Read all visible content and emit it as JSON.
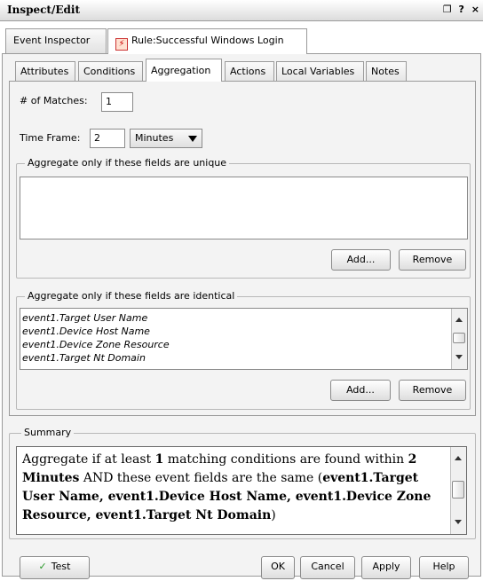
{
  "window": {
    "title": "Inspect/Edit",
    "controls": [
      "❐",
      "?",
      "×"
    ]
  },
  "outer_tabs": [
    {
      "label": "Event Inspector",
      "active": false
    },
    {
      "label": "Rule:Successful Windows Login",
      "active": true,
      "icon": "warning-icon"
    }
  ],
  "inner_tabs": [
    {
      "label": "Attributes",
      "active": false
    },
    {
      "label": "Conditions",
      "active": false
    },
    {
      "label": "Aggregation",
      "active": true
    },
    {
      "label": "Actions",
      "active": false
    },
    {
      "label": "Local Variables",
      "active": false
    },
    {
      "label": "Notes",
      "active": false
    }
  ],
  "aggregation": {
    "matches_label": "# of Matches:",
    "matches_value": "1",
    "timeframe_label": "Time Frame:",
    "timeframe_value": "2",
    "timeframe_unit": "Minutes",
    "unique_group": {
      "title": "Aggregate only if these fields are unique",
      "items": [],
      "add_label": "Add...",
      "remove_label": "Remove"
    },
    "identical_group": {
      "title": "Aggregate only if these fields are identical",
      "items": [
        "event1.Target User Name",
        "event1.Device Host Name",
        "event1.Device Zone Resource",
        "event1.Target Nt Domain"
      ],
      "add_label": "Add...",
      "remove_label": "Remove"
    }
  },
  "summary": {
    "title": "Summary",
    "text_parts": [
      {
        "text": "Aggregate if at least ",
        "bold": false
      },
      {
        "text": "1",
        "bold": true
      },
      {
        "text": " matching conditions are found within ",
        "bold": false
      },
      {
        "text": "2 Minutes",
        "bold": true
      },
      {
        "text": " AND these event fields are the same (",
        "bold": false
      },
      {
        "text": "event1.Target User Name, event1.Device Host Name, event1.Device Zone Resource, event1.Target Nt Domain",
        "bold": true
      },
      {
        "text": ")",
        "bold": false
      }
    ]
  },
  "footer": {
    "test_label": "Test",
    "ok_label": "OK",
    "cancel_label": "Cancel",
    "apply_label": "Apply",
    "help_label": "Help"
  },
  "colors": {
    "panel_bg": "#f3f3f3",
    "border": "#9a9a9a",
    "test_check": "#2a9a2a"
  }
}
